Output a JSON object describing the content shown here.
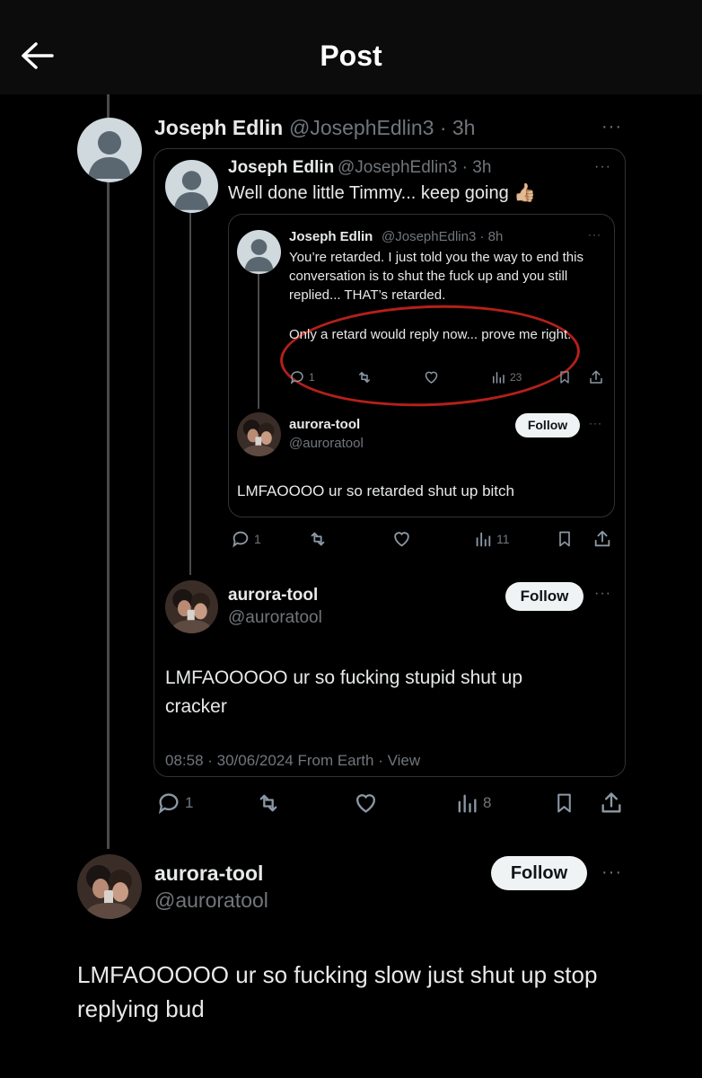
{
  "header": {
    "title": "Post"
  },
  "post": {
    "author_name": "Joseph Edlin",
    "author_meta": "@JosephEdlin3 · 3h",
    "more": "···",
    "quote": {
      "author_name": "Joseph Edlin",
      "author_meta": "@JosephEdlin3 · 3h",
      "text": "Well done little Timmy... keep going 👍🏼",
      "more": "···",
      "inner_quote": {
        "author_name": "Joseph Edlin",
        "author_meta": "@JosephEdlin3 · 8h",
        "text": "You’re retarded. I just told you the way to end this conversation is to shut the fuck up and you still replied... THAT’s retarded.",
        "circled_text": "Only a retard would reply now... prove me right.",
        "more": "···",
        "actions": {
          "replies": "1",
          "views": "23"
        },
        "reply": {
          "name": "aurora-tool",
          "handle": "@auroratool",
          "follow": "Follow",
          "text": "LMFAOOOO ur so retarded shut up bitch"
        }
      },
      "actions": {
        "replies": "1",
        "views": "11"
      },
      "reply": {
        "name": "aurora-tool",
        "handle": "@auroratool",
        "follow": "Follow",
        "text": "LMFAOOOOO ur so fucking stupid shut up cracker",
        "timestamp": "08:58 · 30/06/2024 From Earth · View"
      }
    },
    "actions": {
      "replies": "1",
      "views": "8"
    }
  },
  "reply": {
    "name": "aurora-tool",
    "handle": "@auroratool",
    "follow": "Follow",
    "text": "LMFAOOOOO ur so fucking slow just shut up stop replying bud",
    "more": "···"
  },
  "colors": {
    "bg": "#000000",
    "text": "#e7e9ea",
    "muted": "#71767b",
    "border": "#2f3336",
    "annotation": "#b5201a"
  }
}
